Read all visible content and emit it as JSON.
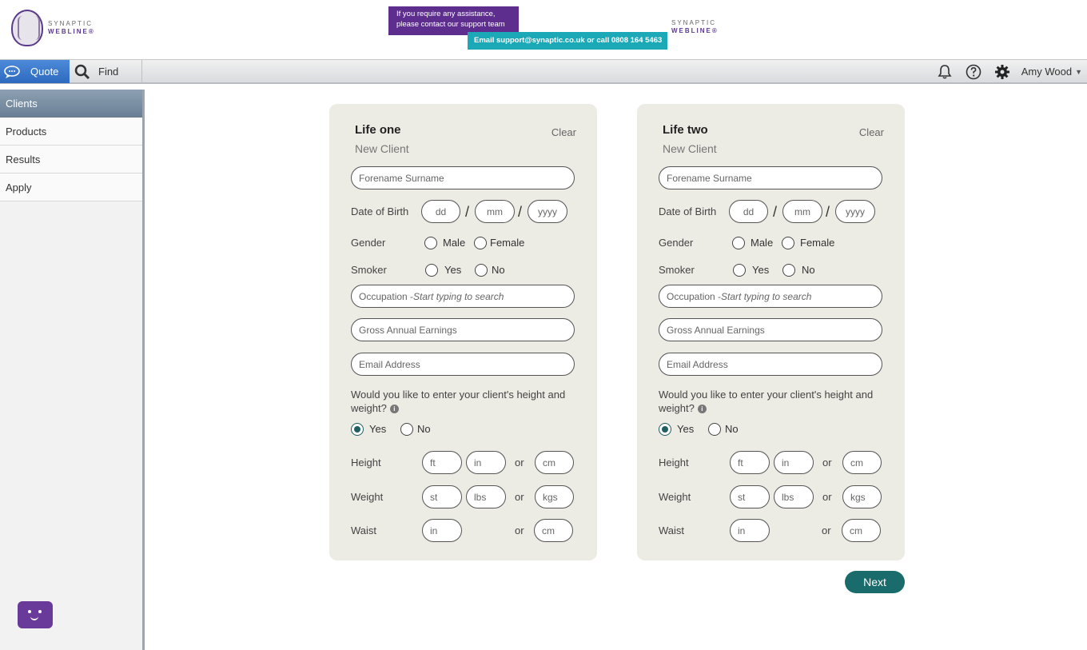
{
  "brand": {
    "line1": "SYNAPTIC",
    "line2": "WEBLINE®"
  },
  "banner": {
    "assist_line1": "If you require any assistance,",
    "assist_line2": "please contact our support team",
    "contact": "Email support@synaptic.co.uk or call 0808 164 5463"
  },
  "toolbar": {
    "quote_label": "Quote",
    "find_label": "Find",
    "user_name": "Amy Wood",
    "caret": "▼"
  },
  "sidebar": {
    "items": [
      {
        "label": "Clients",
        "active": true
      },
      {
        "label": "Products"
      },
      {
        "label": "Results"
      },
      {
        "label": "Apply"
      }
    ]
  },
  "form_labels": {
    "dob": "Date of Birth",
    "gender": "Gender",
    "male": "Male",
    "female": "Female",
    "smoker": "Smoker",
    "yes": "Yes",
    "no": "No",
    "height": "Height",
    "weight": "Weight",
    "waist": "Waist",
    "or": "or",
    "hw_question": "Would you like to enter your client's height and weight?",
    "info": "i",
    "slash": "/"
  },
  "placeholders": {
    "name": "Forename Surname",
    "dd": "dd",
    "mm": "mm",
    "yyyy": "yyyy",
    "occupation": "Occupation - ",
    "occupation_hint": "Start typing to search",
    "earnings": "Gross Annual Earnings",
    "email": "Email Address",
    "ft": "ft",
    "in": "in",
    "cm": "cm",
    "st": "st",
    "lbs": "lbs",
    "kgs": "kgs"
  },
  "life_one": {
    "title": "Life one",
    "subtitle": "New Client",
    "clear": "Clear"
  },
  "life_two": {
    "title": "Life two",
    "subtitle": "New Client",
    "clear": "Clear"
  },
  "actions": {
    "next": "Next"
  }
}
